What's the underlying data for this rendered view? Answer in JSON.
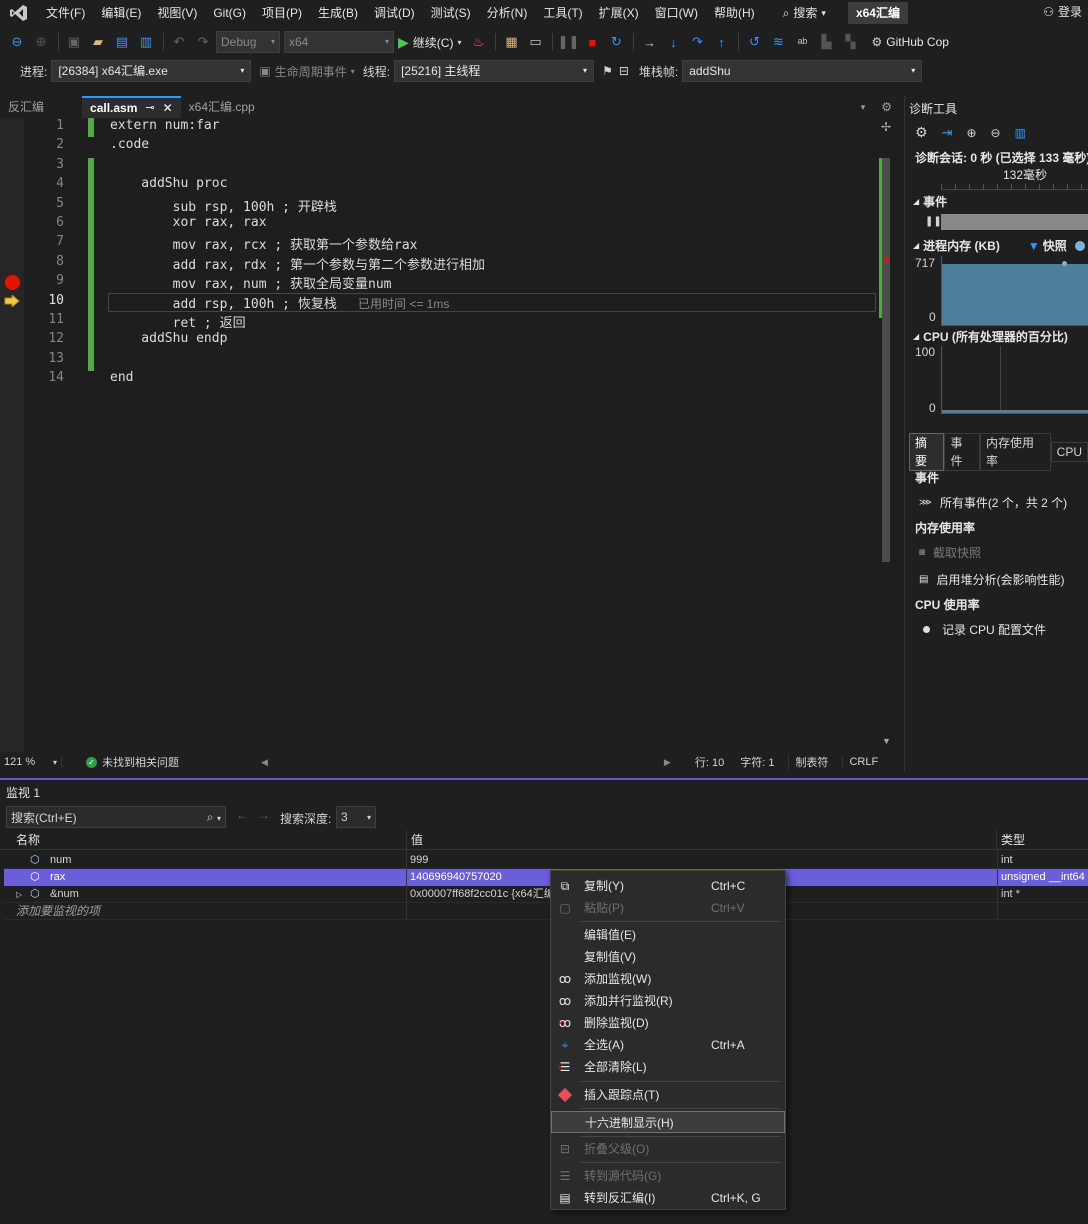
{
  "menubar": {
    "items": [
      "文件(F)",
      "编辑(E)",
      "视图(V)",
      "Git(G)",
      "项目(P)",
      "生成(B)",
      "调试(D)",
      "测试(S)",
      "分析(N)",
      "工具(T)",
      "扩展(X)",
      "窗口(W)",
      "帮助(H)"
    ],
    "search": "搜索",
    "solution": "x64汇编",
    "login": "登录"
  },
  "toolbar": {
    "config": "Debug",
    "platform": "x64",
    "continue": "继续(C)",
    "github": "GitHub Cop"
  },
  "toolbar2": {
    "process_label": "进程:",
    "process": "[26384] x64汇编.exe",
    "lifecycle": "生命周期事件",
    "thread_label": "线程:",
    "thread": "[25216] 主线程",
    "stack_label": "堆栈帧:",
    "stack": "addShu"
  },
  "tabs": [
    {
      "label": "反汇编"
    },
    {
      "label": "call.asm"
    },
    {
      "label": "x64汇编.cpp"
    }
  ],
  "editor": {
    "lines": [
      {
        "n": "1",
        "text": "extern num:far"
      },
      {
        "n": "2",
        "text": ".code"
      },
      {
        "n": "3",
        "text": ""
      },
      {
        "n": "4",
        "text": "    addShu proc"
      },
      {
        "n": "5",
        "text": "        sub rsp, 100h ; 开辟栈"
      },
      {
        "n": "6",
        "text": "        xor rax, rax"
      },
      {
        "n": "7",
        "text": "        mov rax, rcx ; 获取第一个参数给rax"
      },
      {
        "n": "8",
        "text": "        add rax, rdx ; 第一个参数与第二个参数进行相加"
      },
      {
        "n": "9",
        "text": "        mov rax, num ; 获取全局变量num"
      },
      {
        "n": "10",
        "text": "        add rsp, 100h ; 恢复栈"
      },
      {
        "n": "11",
        "text": "        ret ; 返回"
      },
      {
        "n": "12",
        "text": "    addShu endp"
      },
      {
        "n": "13",
        "text": ""
      },
      {
        "n": "14",
        "text": "end"
      }
    ],
    "perf_tip": "已用时间 <= 1ms"
  },
  "status": {
    "zoom": "121 %",
    "issues": "未找到相关问题",
    "line": "行: 10",
    "char": "字符: 1",
    "tab": "制表符",
    "eol": "CRLF"
  },
  "diag": {
    "title": "诊断工具",
    "session": "诊断会话: 0 秒 (已选择 133 毫秒)",
    "tick": "132毫秒",
    "events": "事件",
    "memory_label": "进程内存 (KB)",
    "snapshot": "快照",
    "mem_max": "717",
    "mem_min": "0",
    "cpu_label": "CPU (所有处理器的百分比)",
    "cpu_max": "100",
    "cpu_min": "0",
    "tabs": [
      "摘要",
      "事件",
      "内存使用率",
      "CPU"
    ],
    "sec_events": "事件",
    "all_events": "所有事件(2 个，共 2 个)",
    "sec_memory": "内存使用率",
    "take_snapshot": "截取快照",
    "heap": "启用堆分析(会影响性能)",
    "sec_cpu": "CPU 使用率",
    "record_cpu": "记录 CPU 配置文件",
    "mem_value_fraction": 0.88,
    "cpu_value_fraction": 0.04
  },
  "watch": {
    "title": "监视 1",
    "search_placeholder": "搜索(Ctrl+E)",
    "depth_label": "搜索深度:",
    "depth": "3",
    "col_name": "名称",
    "col_value": "值",
    "col_type": "类型",
    "rows": [
      {
        "name": "num",
        "value": "999",
        "type": "int"
      },
      {
        "name": "rax",
        "value": "140696940757020",
        "type": "unsigned __int64"
      },
      {
        "name": "&num",
        "value": "0x00007ff68f2cc01c {x64汇编.exe!num}",
        "type": "int *"
      }
    ],
    "add_hint": "添加要监视的项"
  },
  "context_menu": {
    "items": [
      {
        "label": "复制(Y)",
        "shortcut": "Ctrl+C",
        "icon": "copy-icon",
        "disabled": false
      },
      {
        "label": "粘贴(P)",
        "shortcut": "Ctrl+V",
        "icon": "paste-icon",
        "disabled": true
      },
      {
        "label": "编辑值(E)",
        "shortcut": "",
        "icon": "",
        "disabled": false
      },
      {
        "label": "复制值(V)",
        "shortcut": "",
        "icon": "",
        "disabled": false
      },
      {
        "label": "添加监视(W)",
        "shortcut": "",
        "icon": "glasses-icon",
        "disabled": false
      },
      {
        "label": "添加并行监视(R)",
        "shortcut": "",
        "icon": "glasses-icon",
        "disabled": false
      },
      {
        "label": "删除监视(D)",
        "shortcut": "",
        "icon": "delete-watch-icon",
        "disabled": false
      },
      {
        "label": "全选(A)",
        "shortcut": "Ctrl+A",
        "icon": "select-all-icon",
        "disabled": false
      },
      {
        "label": "全部清除(L)",
        "shortcut": "",
        "icon": "clear-all-icon",
        "disabled": false
      },
      {
        "label": "插入跟踪点(T)",
        "shortcut": "",
        "icon": "tracepoint-icon",
        "disabled": false
      },
      {
        "label": "十六进制显示(H)",
        "shortcut": "",
        "icon": "",
        "disabled": false
      },
      {
        "label": "折叠父级(O)",
        "shortcut": "",
        "icon": "collapse-icon",
        "disabled": true
      },
      {
        "label": "转到源代码(G)",
        "shortcut": "",
        "icon": "goto-source-icon",
        "disabled": true
      },
      {
        "label": "转到反汇编(I)",
        "shortcut": "Ctrl+K, G",
        "icon": "disasm-icon",
        "disabled": false
      }
    ]
  },
  "colors": {
    "accent": "#7160e8",
    "breakpoint": "#e51400",
    "change_bar": "#57a64a"
  }
}
